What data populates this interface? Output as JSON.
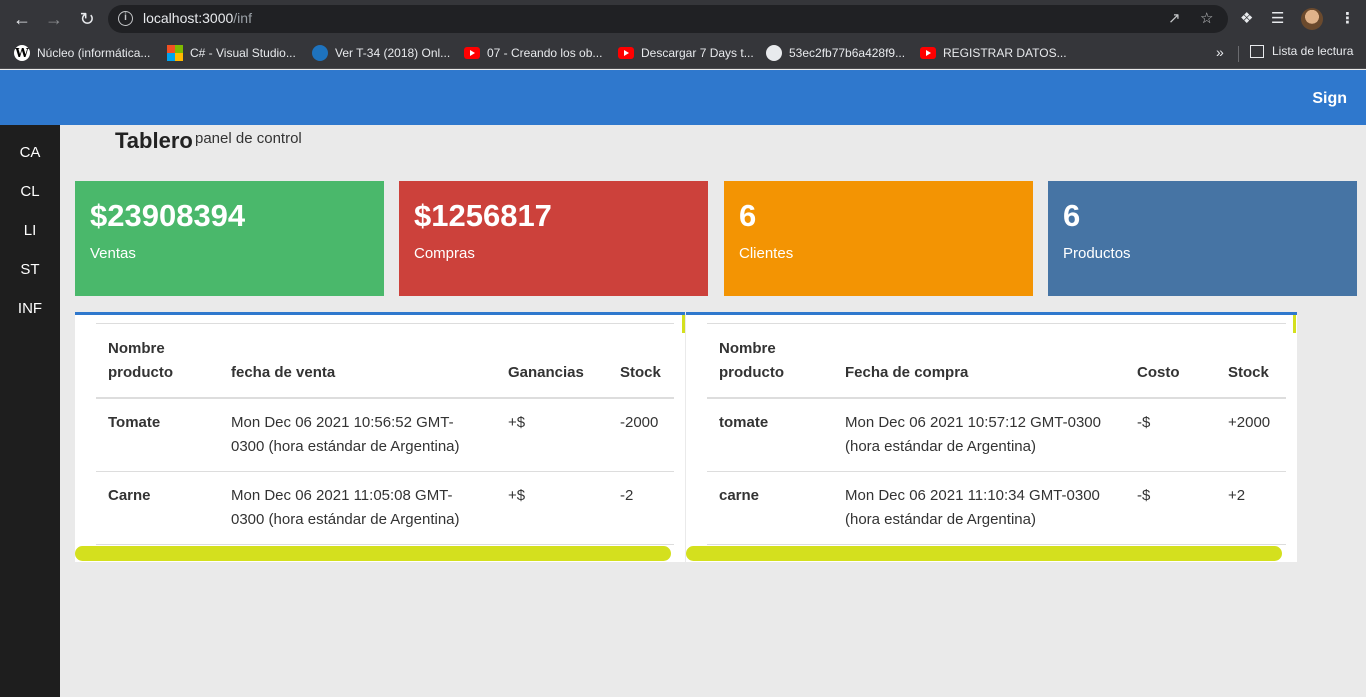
{
  "browser": {
    "url_host": "localhost:3000",
    "url_path": "/inf",
    "bookmarks": [
      {
        "label": "Núcleo (informática...",
        "icon": "wikipedia-icon"
      },
      {
        "label": "C# - Visual Studio...",
        "icon": "microsoft-icon"
      },
      {
        "label": "Ver T-34 (2018) Onl...",
        "icon": "edge-icon"
      },
      {
        "label": "07 - Creando los ob...",
        "icon": "youtube-icon"
      },
      {
        "label": "Descargar 7 Days t...",
        "icon": "youtube-icon"
      },
      {
        "label": "53ec2fb77b6a428f9...",
        "icon": "globe-icon"
      },
      {
        "label": "REGISTRAR DATOS...",
        "icon": "youtube-icon"
      }
    ],
    "more_bookmarks": "»",
    "reading_list": "Lista de lectura"
  },
  "header": {
    "sign_label": "Sign",
    "color": "#2f78cd"
  },
  "sidebar": {
    "items": [
      {
        "label": "CA"
      },
      {
        "label": "CL"
      },
      {
        "label": "LI"
      },
      {
        "label": "ST"
      },
      {
        "label": "INF"
      }
    ]
  },
  "page": {
    "title": "Tablero",
    "subtitle": "panel de control"
  },
  "cards": [
    {
      "value": "$23908394",
      "label": "Ventas",
      "color": "#4ab86b"
    },
    {
      "value": "$1256817",
      "label": "Compras",
      "color": "#cc413b"
    },
    {
      "value": "6",
      "label": "Clientes",
      "color": "#f39403"
    },
    {
      "value": "6",
      "label": "Productos",
      "color": "#4674a4"
    }
  ],
  "sales_table": {
    "headers": [
      "Nombre producto",
      "fecha de venta",
      "Ganancias",
      "Stock"
    ],
    "rows": [
      [
        "Tomate",
        "Mon Dec 06 2021 10:56:52 GMT-0300 (hora estándar de Argentina)",
        "+$",
        "-2000"
      ],
      [
        "Carne",
        "Mon Dec 06 2021 11:05:08 GMT-0300 (hora estándar de Argentina)",
        "+$",
        "-2"
      ]
    ]
  },
  "purchases_table": {
    "headers": [
      "Nombre producto",
      "Fecha de compra",
      "Costo",
      "Stock"
    ],
    "rows": [
      [
        "tomate",
        "Mon Dec 06 2021 10:57:12 GMT-0300 (hora estándar de Argentina)",
        "-$",
        "+2000"
      ],
      [
        "carne",
        "Mon Dec 06 2021 11:10:34 GMT-0300 (hora estándar de Argentina)",
        "-$",
        "+2"
      ]
    ]
  }
}
